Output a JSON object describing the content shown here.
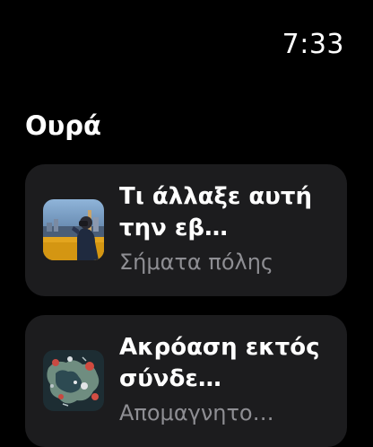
{
  "status": {
    "time": "7:33"
  },
  "page": {
    "title": "Ουρά"
  },
  "queue": {
    "items": [
      {
        "title": "Τι άλλαξε αυτή την εβ…",
        "subtitle": "Σήματα πόλης",
        "artwork_icon": "podcast-artwork-city-signals"
      },
      {
        "title": "Ακρόαση εκτός σύνδε…",
        "subtitle": "Απομαγνητο…",
        "artwork_icon": "podcast-artwork-map"
      }
    ]
  },
  "colors": {
    "background": "#000000",
    "card": "#1c1c1e",
    "text_primary": "#ffffff",
    "text_secondary": "#8e8e93"
  }
}
